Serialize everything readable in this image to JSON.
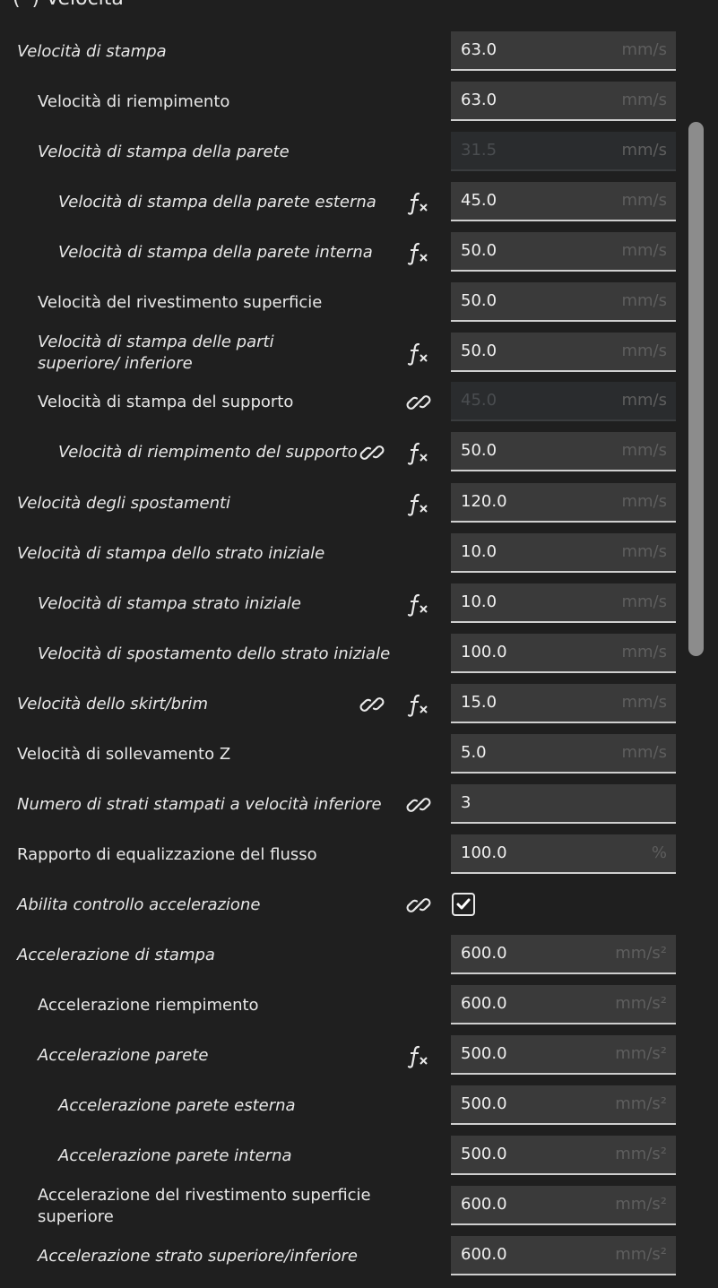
{
  "section": {
    "title": "(•) Velocità"
  },
  "rows": [
    {
      "label": "Velocità di stampa",
      "value": "63.0",
      "unit": "mm/s"
    },
    {
      "label": "Velocità di riempimento",
      "value": "63.0",
      "unit": "mm/s"
    },
    {
      "label": "Velocità di stampa della parete",
      "value": "31.5",
      "unit": "mm/s"
    },
    {
      "label": "Velocità di stampa della parete esterna",
      "value": "45.0",
      "unit": "mm/s"
    },
    {
      "label": "Velocità di stampa della parete interna",
      "value": "50.0",
      "unit": "mm/s"
    },
    {
      "label": "Velocità del rivestimento superficie",
      "value": "50.0",
      "unit": "mm/s"
    },
    {
      "label": "Velocità di stampa delle parti superiore/ inferiore",
      "value": "50.0",
      "unit": "mm/s"
    },
    {
      "label": "Velocità di stampa del supporto",
      "value": "45.0",
      "unit": "mm/s"
    },
    {
      "label": "Velocità di riempimento del supporto",
      "value": "50.0",
      "unit": "mm/s"
    },
    {
      "label": "Velocità degli spostamenti",
      "value": "120.0",
      "unit": "mm/s"
    },
    {
      "label": "Velocità di stampa dello strato iniziale",
      "value": "10.0",
      "unit": "mm/s"
    },
    {
      "label": "Velocità di stampa strato iniziale",
      "value": "10.0",
      "unit": "mm/s"
    },
    {
      "label": "Velocità di spostamento dello strato iniziale",
      "value": "100.0",
      "unit": "mm/s"
    },
    {
      "label": "Velocità dello skirt/brim",
      "value": "15.0",
      "unit": "mm/s"
    },
    {
      "label": "Velocità di sollevamento Z",
      "value": "5.0",
      "unit": "mm/s"
    },
    {
      "label": "Numero di strati stampati a velocità inferiore",
      "value": "3",
      "unit": ""
    },
    {
      "label": "Rapporto di equalizzazione del flusso",
      "value": "100.0",
      "unit": "%"
    },
    {
      "label": "Abilita controllo accelerazione",
      "checked": true
    },
    {
      "label": "Accelerazione di stampa",
      "value": "600.0",
      "unit": "mm/s²"
    },
    {
      "label": "Accelerazione riempimento",
      "value": "600.0",
      "unit": "mm/s²"
    },
    {
      "label": "Accelerazione parete",
      "value": "500.0",
      "unit": "mm/s²"
    },
    {
      "label": "Accelerazione parete esterna",
      "value": "500.0",
      "unit": "mm/s²"
    },
    {
      "label": "Accelerazione parete interna",
      "value": "500.0",
      "unit": "mm/s²"
    },
    {
      "label": "Accelerazione del rivestimento superficie superiore",
      "value": "600.0",
      "unit": "mm/s²"
    },
    {
      "label": "Accelerazione strato superiore/inferiore",
      "value": "600.0",
      "unit": "mm/s²"
    }
  ]
}
